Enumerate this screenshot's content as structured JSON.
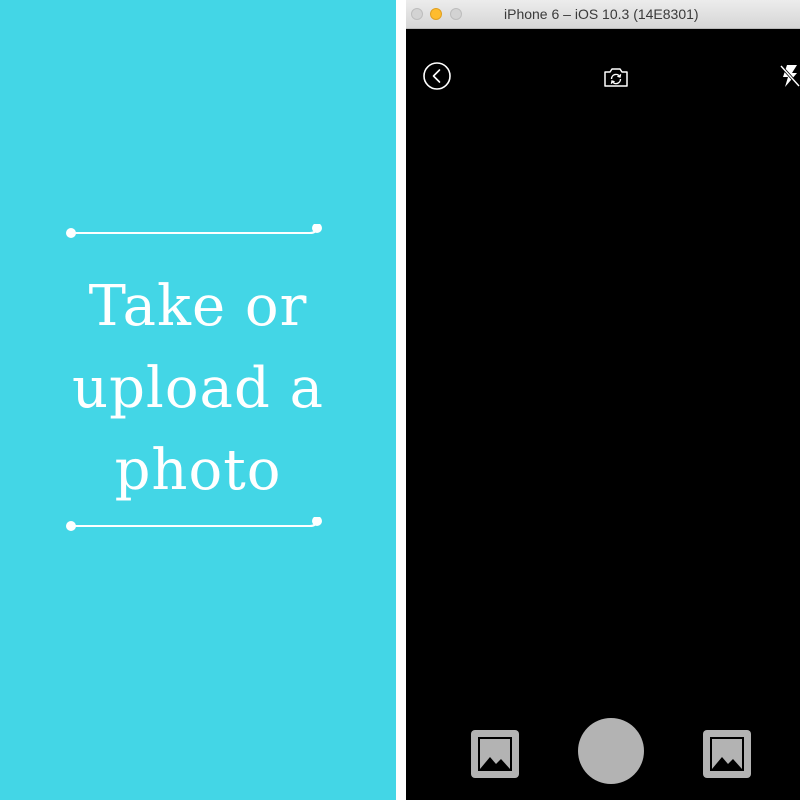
{
  "promo": {
    "title": "Take or\nupload a\nphoto",
    "background_color": "#43d6e6",
    "text_color": "#ffffff"
  },
  "simulator": {
    "window_title": "iPhone 6 – iOS 10.3 (14E8301)",
    "traffic_lights": [
      "close",
      "minimize",
      "zoom"
    ],
    "camera": {
      "top_bar": {
        "back_icon": "chevron-left-circle-icon",
        "flip_icon": "camera-flip-icon",
        "flash_icon": "flash-off-icon"
      },
      "bottom_bar": {
        "left_gallery_icon": "image-icon",
        "shutter_icon": "shutter-button",
        "right_gallery_icon": "image-icon"
      }
    }
  }
}
